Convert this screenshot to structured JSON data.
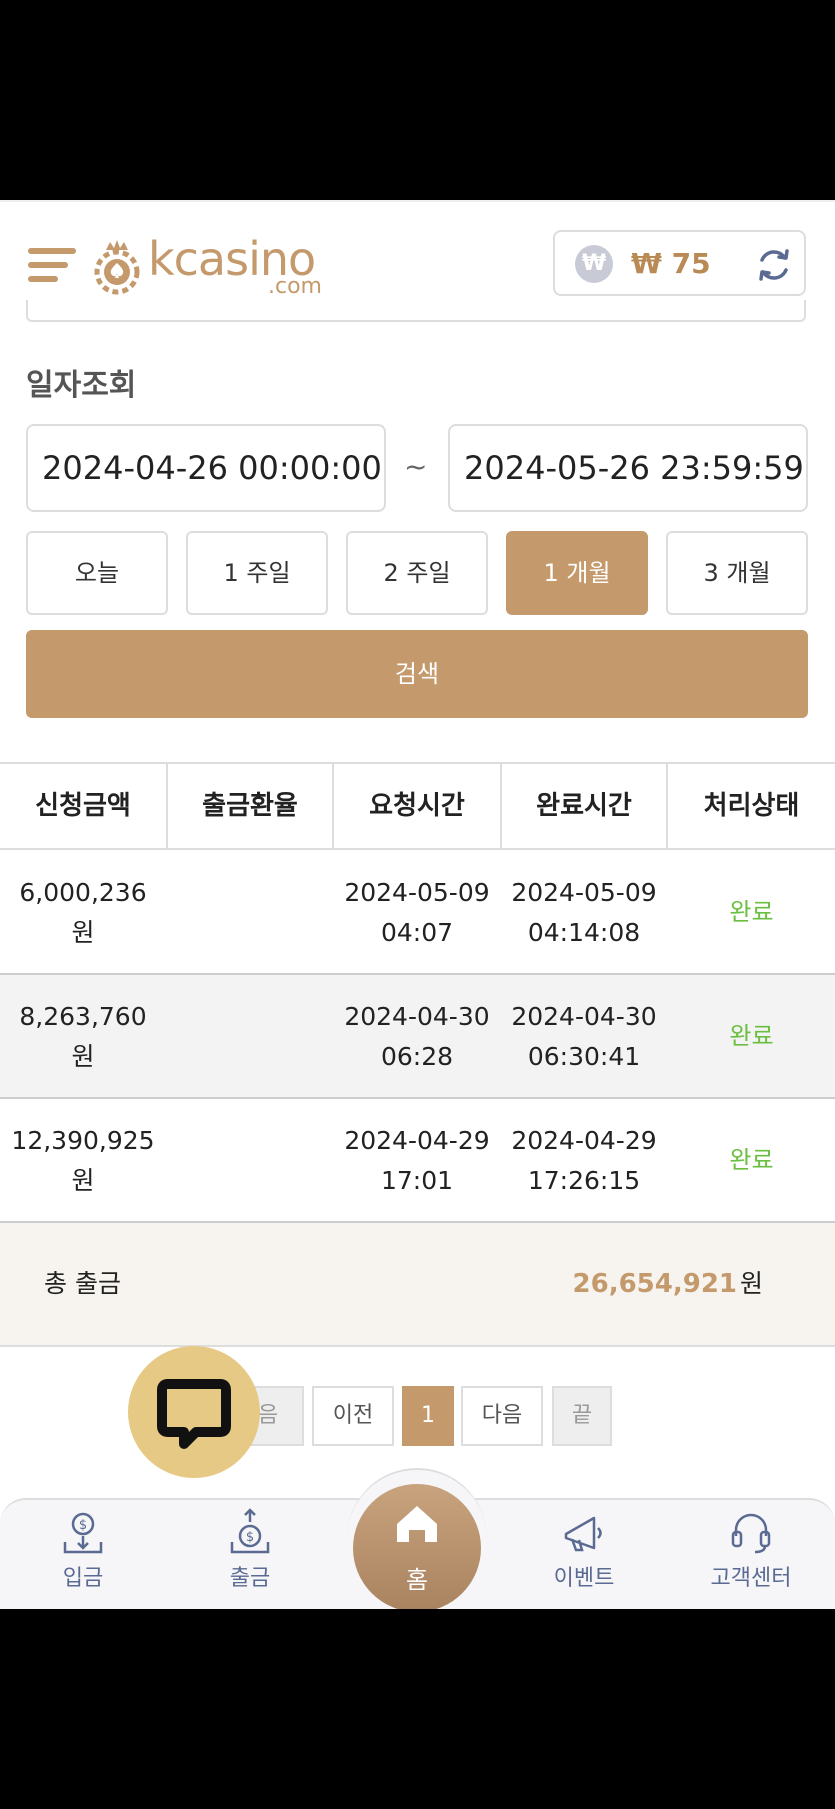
{
  "header": {
    "logo_text": "kcasino",
    "logo_sub": ".com",
    "balance": "₩ 75",
    "currency_symbol": "₩"
  },
  "filter": {
    "title": "일자조회",
    "date_from": "2024-04-26 00:00:00",
    "date_to": "2024-05-26 23:59:59",
    "separator": "~",
    "periods": [
      "오늘",
      "1 주일",
      "2 주일",
      "1 개월",
      "3 개월"
    ],
    "active_period": "1 개월",
    "search_label": "검색"
  },
  "table": {
    "columns": [
      "신청금액",
      "출금환율",
      "요청시간",
      "완료시간",
      "처리상태"
    ],
    "rows": [
      {
        "amount": "6,000,236",
        "unit": "원",
        "rate": "",
        "req_date": "2024-05-09",
        "req_time": "04:07",
        "done_date": "2024-05-09",
        "done_time": "04:14:08",
        "status": "완료"
      },
      {
        "amount": "8,263,760",
        "unit": "원",
        "rate": "",
        "req_date": "2024-04-30",
        "req_time": "06:28",
        "done_date": "2024-04-30",
        "done_time": "06:30:41",
        "status": "완료"
      },
      {
        "amount": "12,390,925",
        "unit": "원",
        "rate": "",
        "req_date": "2024-04-29",
        "req_time": "17:01",
        "done_date": "2024-04-29",
        "done_time": "17:26:15",
        "status": "완료"
      }
    ],
    "total_label": "총 출금",
    "total_amount": "26,654,921",
    "total_unit": "원"
  },
  "pagination": {
    "first_partial": "음",
    "prev": "이전",
    "current": "1",
    "next": "다음",
    "last": "끝"
  },
  "nav": {
    "deposit": "입금",
    "withdraw": "출금",
    "home": "홈",
    "event": "이벤트",
    "support": "고객센터"
  },
  "colors": {
    "accent": "#c49a6c",
    "status_done": "#6abf40",
    "nav_text": "#5a6a92"
  },
  "icons": [
    "menu-icon",
    "logo-icon",
    "won-icon",
    "refresh-icon",
    "chat-icon",
    "deposit-icon",
    "withdraw-icon",
    "home-icon",
    "megaphone-icon",
    "headset-icon"
  ]
}
